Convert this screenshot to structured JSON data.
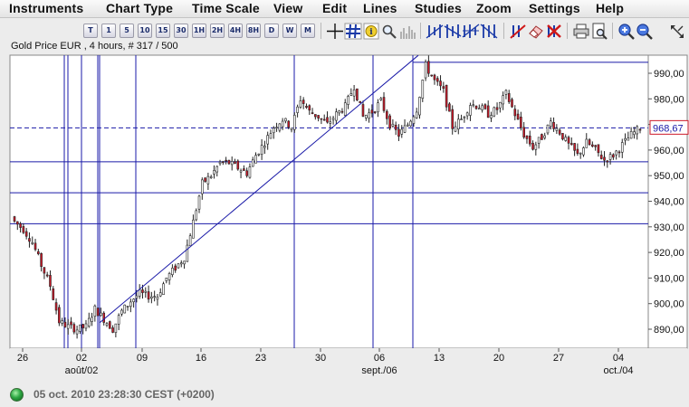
{
  "menu": [
    "Instruments",
    "Chart Type",
    "Time Scale",
    "View",
    "Edit",
    "Lines",
    "Studies",
    "Zoom",
    "Settings",
    "Help"
  ],
  "toolbar": {
    "timescale_buttons": [
      "T",
      "1",
      "5",
      "10",
      "15",
      "30",
      "1H",
      "2H",
      "4H",
      "8H",
      "D",
      "W",
      "M"
    ],
    "icons": [
      "crosshair-icon",
      "grid-icon",
      "info-icon",
      "search-icon",
      "volume-bars-icon",
      "bar-chart-icon",
      "trend-line-icon",
      "fibonacci-icon",
      "delete-line-icon",
      "color-palette-icon",
      "eraser-icon",
      "clear-all-icon",
      "print-icon",
      "print-preview-icon",
      "zoom-in-icon",
      "zoom-out-icon",
      "expand-arrows-icon"
    ]
  },
  "chart": {
    "title": "Gold Price EUR , 4 hours, # 317 / 500",
    "current_price_label": "968,67",
    "colors": {
      "lines": "#1a1aa8",
      "up_candle": "#ffffff",
      "down_candle": "#cc1a2a",
      "candle_outline": "#222222"
    }
  },
  "chart_data": {
    "type": "candlestick",
    "title": "Gold Price EUR , 4 hours, # 317 / 500",
    "xlabel": "",
    "ylabel": "",
    "x_ticks": [
      "26",
      "02",
      "09",
      "16",
      "23",
      "30",
      "06",
      "13",
      "20",
      "27",
      "04"
    ],
    "x_month_labels": [
      {
        "label": "août/02",
        "at": "02"
      },
      {
        "label": "sept./06",
        "at": "06"
      },
      {
        "label": "oct./04",
        "at": "04"
      }
    ],
    "y_ticks": [
      "890,00",
      "900,00",
      "910,00",
      "920,00",
      "930,00",
      "940,00",
      "950,00",
      "960,00",
      "970,00",
      "980,00",
      "990,00"
    ],
    "ylim": [
      885,
      995
    ],
    "current_price": 968.67,
    "horizontal_lines": [
      931.2,
      943.3,
      955.4,
      994.3
    ],
    "dashed_horizontal_line": 968.67,
    "trend_line": {
      "start": {
        "x": "04",
        "y": 892.5
      },
      "end": {
        "x": "10",
        "y": 997
      }
    },
    "close_series": [
      932,
      929,
      924,
      915,
      907,
      893,
      891,
      890,
      891,
      898,
      894,
      890,
      897,
      901,
      904,
      903,
      903,
      910,
      914,
      918,
      932,
      947,
      950,
      955,
      955,
      953,
      951,
      958,
      963,
      969,
      972,
      969,
      980,
      975,
      973,
      970,
      974,
      977,
      985,
      973,
      975,
      979,
      970,
      966,
      970,
      976,
      993,
      987,
      983,
      969,
      972,
      978,
      977,
      974,
      976,
      982,
      974,
      966,
      961,
      965,
      971,
      967,
      962,
      958,
      963,
      960,
      956,
      958,
      962,
      966,
      968.67
    ]
  },
  "status": {
    "text": "05 oct. 2010 23:28:30 CEST (+0200)"
  }
}
